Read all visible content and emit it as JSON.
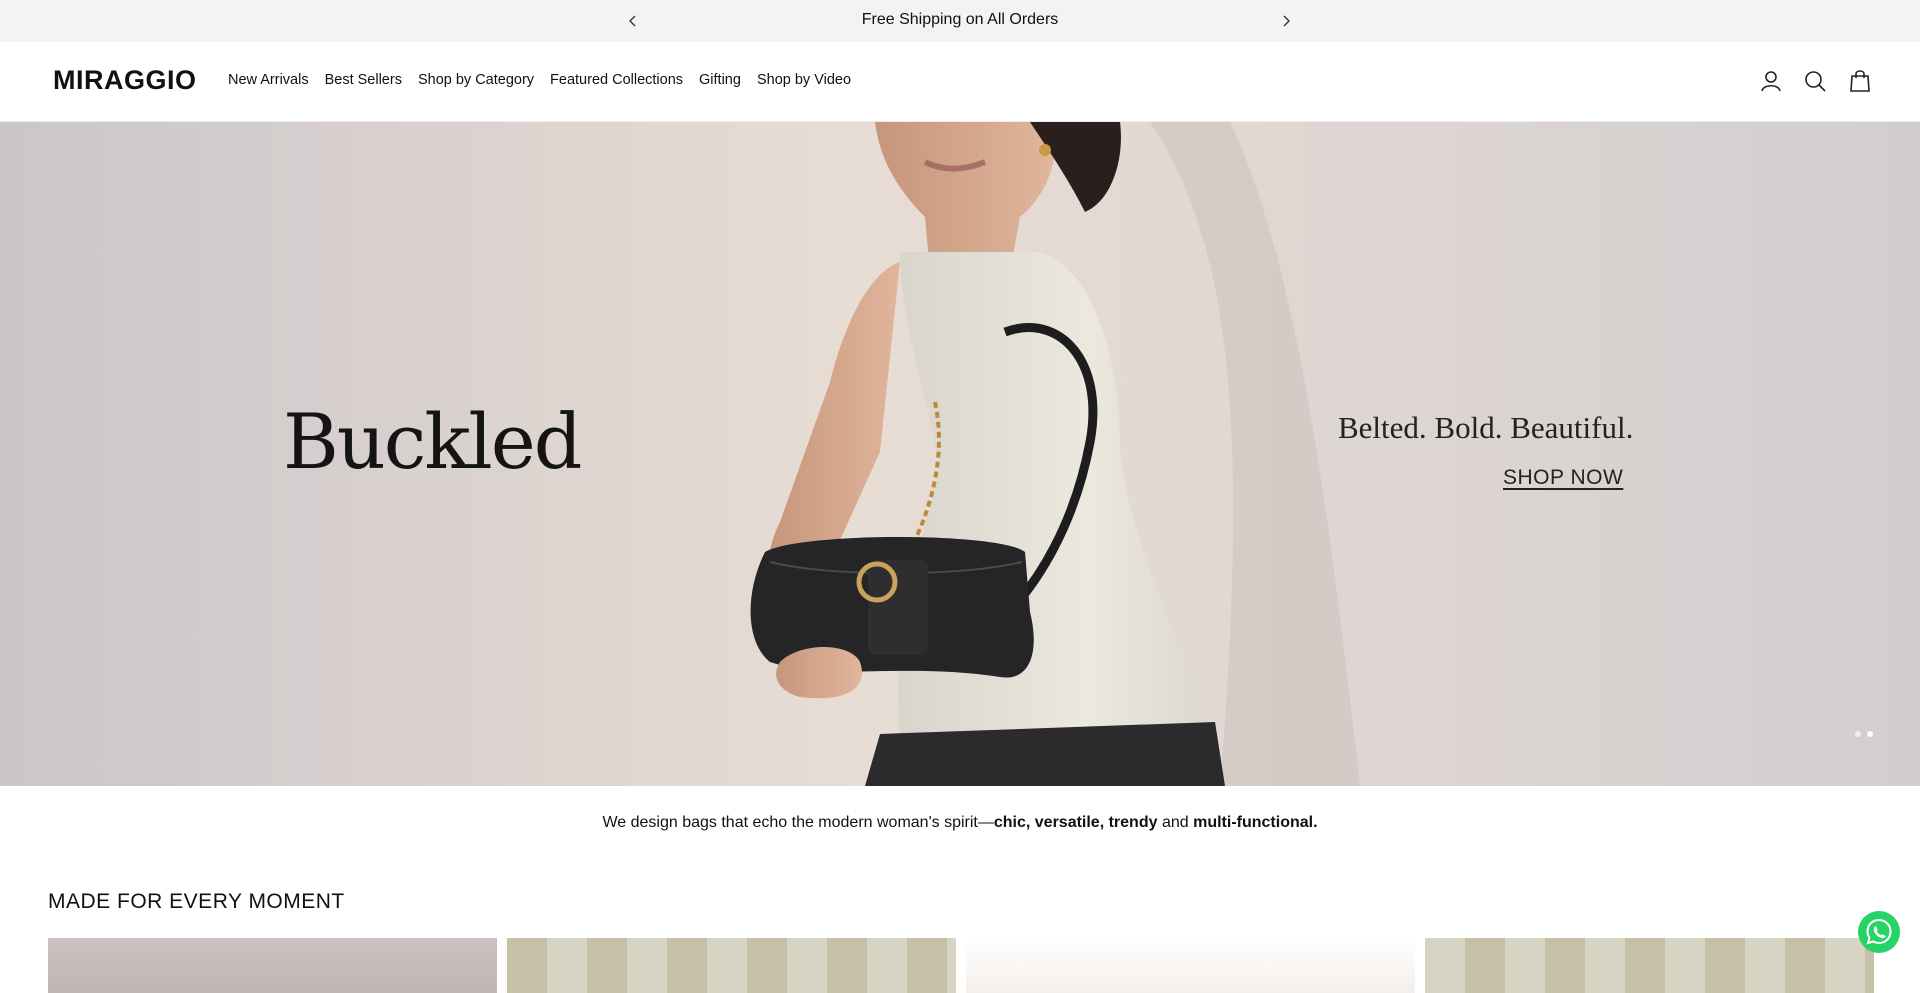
{
  "announcement": {
    "text": "Free Shipping on All Orders",
    "prev_icon": "chevron-left-icon",
    "next_icon": "chevron-right-icon"
  },
  "header": {
    "logo": "MIRAGGIO",
    "nav": [
      "New Arrivals",
      "Best Sellers",
      "Shop by Category",
      "Featured Collections",
      "Gifting",
      "Shop by Video"
    ],
    "icons": [
      "user-icon",
      "search-icon",
      "bag-icon"
    ]
  },
  "hero": {
    "brand": "Buckled",
    "tagline": "Belted. Bold. Beautiful.",
    "cta": "SHOP NOW",
    "slide_count": 2,
    "active_slide": 2
  },
  "intro": {
    "lead": "We design bags that echo the modern woman's spirit—",
    "bold1": "chic, versatile, trendy",
    "mid": " and ",
    "bold2": "multi-functional."
  },
  "section": {
    "title": "MADE FOR EVERY MOMENT",
    "card_count": 4
  },
  "chat": {
    "icon": "whatsapp-icon",
    "color": "#25d366"
  }
}
